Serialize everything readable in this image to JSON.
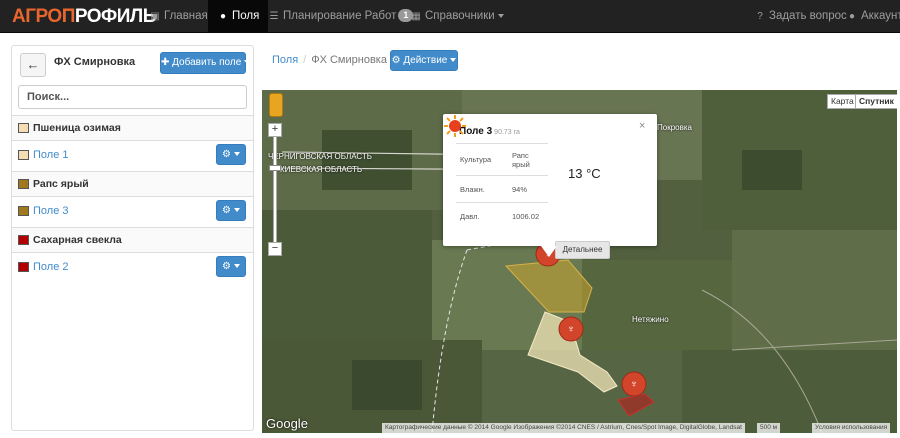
{
  "brand": {
    "part1": "АГРО",
    "part2": "П",
    "part3": "РОФИЛЬ"
  },
  "nav": {
    "home": "Главная",
    "fields": "Поля",
    "planning": "Планирование Работ",
    "planning_badge": "1",
    "refs": "Справочники",
    "ask": "Задать вопрос",
    "account": "Аккаунт"
  },
  "sidebar": {
    "back": "←",
    "farm": "ФХ Смирновка",
    "add_field": "Добавить поле",
    "search_placeholder": "Поиск...",
    "groups": [
      {
        "crop": "Пшеница озимая",
        "color": "#f5deb3",
        "field": "Поле 1"
      },
      {
        "crop": "Рапс ярый",
        "color": "#a0781e",
        "field": "Поле 3"
      },
      {
        "crop": "Сахарная свекла",
        "color": "#b20000",
        "field": "Поле 2"
      }
    ]
  },
  "breadcrumb": {
    "root": "Поля",
    "sep": "/",
    "current": "ФХ Смирновка"
  },
  "action_button": "Действие",
  "map": {
    "type_map": "Карта",
    "type_satellite": "Спутник",
    "label_chernigov": "ЧЕРНИГОВСКАЯ ОБЛАСТЬ",
    "label_kiev": "КИЕВСКАЯ ОБЛАСТЬ",
    "label_netyazhino": "Нетяжино",
    "label_nokrovka": "Покровка",
    "google": "Google",
    "attribution": "Картографические данные © 2014 Google Изображения ©2014 CNES / Astrium, Cnes/Spot Image, DigitalGlobe, Landsat",
    "scale": "500 м",
    "terms": "Условия использования"
  },
  "popup": {
    "title": "Поле 3",
    "area": "90.73 га",
    "close": "×",
    "rows": [
      {
        "label": "Культура",
        "value": "Рапс ярый"
      },
      {
        "label": "Влажн.",
        "value": "94%"
      },
      {
        "label": "Давл.",
        "value": "1006.02"
      }
    ],
    "temp": "13 °C",
    "details": "Детальнее"
  },
  "colors": {
    "brand_orange": "#e8662e",
    "primary": "#428bca",
    "navbar": "#222222"
  }
}
